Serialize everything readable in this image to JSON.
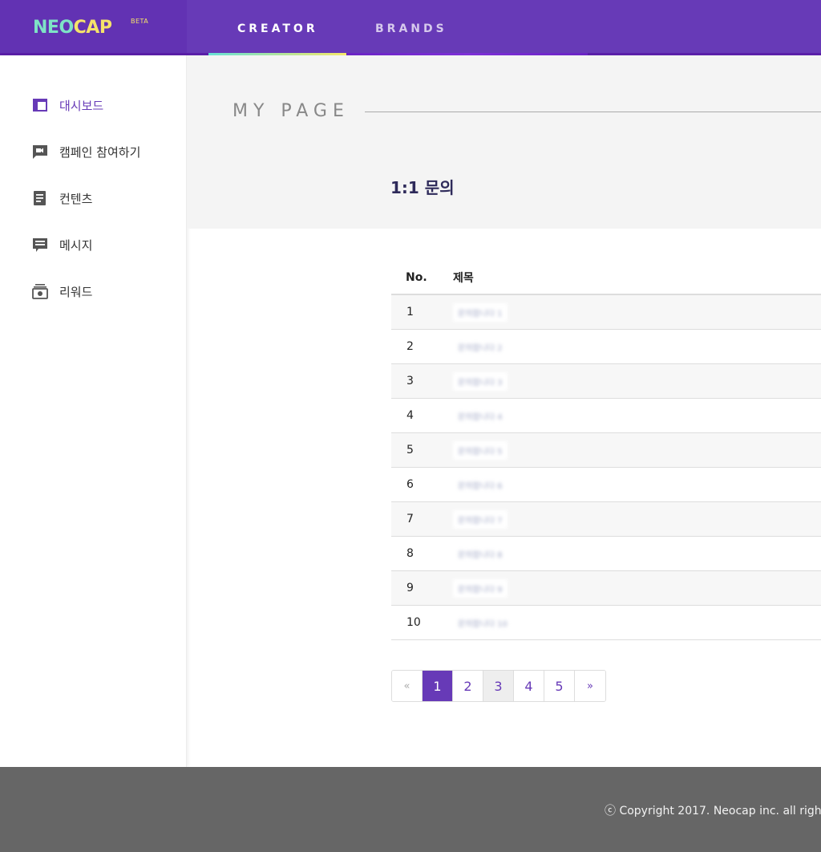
{
  "header": {
    "logo_main": "NEO",
    "logo_cap": "CAP",
    "logo_badge": "BETA",
    "tabs": [
      {
        "label": "CREATOR",
        "active": true
      },
      {
        "label": "BRANDS",
        "active": false
      }
    ],
    "colors": {
      "background": "#673ab7",
      "active_bar_start": "#67e0d6",
      "active_bar_end": "#f6e86a"
    }
  },
  "sidebar": {
    "items": [
      {
        "label": "대시보드",
        "icon": "dashboard-icon",
        "active": true
      },
      {
        "label": "캠페인 참여하기",
        "icon": "video-chat-icon",
        "active": false
      },
      {
        "label": "컨텐츠",
        "icon": "document-icon",
        "active": false
      },
      {
        "label": "메시지",
        "icon": "message-icon",
        "active": false
      },
      {
        "label": "리워드",
        "icon": "reward-icon",
        "active": false
      }
    ]
  },
  "page": {
    "title": "MY PAGE",
    "section_title": "1:1 문의"
  },
  "table": {
    "columns": [
      "No.",
      "제목"
    ],
    "rows": [
      {
        "no": "1",
        "title": "문의합니다 1"
      },
      {
        "no": "2",
        "title": "문의합니다 2"
      },
      {
        "no": "3",
        "title": "문의합니다 3"
      },
      {
        "no": "4",
        "title": "문의합니다 4"
      },
      {
        "no": "5",
        "title": "문의합니다 5"
      },
      {
        "no": "6",
        "title": "문의합니다 6"
      },
      {
        "no": "7",
        "title": "문의합니다 7"
      },
      {
        "no": "8",
        "title": "문의합니다 8"
      },
      {
        "no": "9",
        "title": "문의합니다 9"
      },
      {
        "no": "10",
        "title": "문의합니다 10"
      }
    ]
  },
  "pagination": {
    "prev": "«",
    "pages": [
      "1",
      "2",
      "3",
      "4",
      "5"
    ],
    "current": "1",
    "next": "»"
  },
  "footer": {
    "copyright": "ⓒ Copyright 2017. Neocap inc. all righ"
  }
}
